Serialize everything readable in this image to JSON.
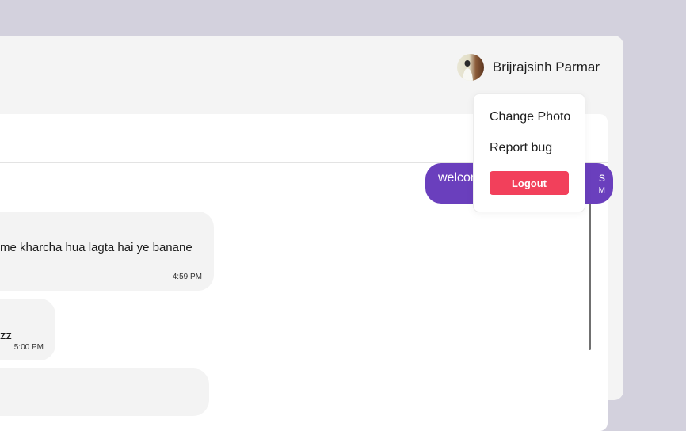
{
  "user": {
    "name": "Brijrajsinh Parmar"
  },
  "dropdown": {
    "items": [
      {
        "label": "Change Photo"
      },
      {
        "label": "Report bug"
      }
    ],
    "logout_label": "Logout"
  },
  "messages": [
    {
      "direction": "outgoing",
      "text": "welcome",
      "text_tail": "s",
      "time": "M"
    },
    {
      "direction": "incoming",
      "text": "me kharcha hua lagta hai ye banane",
      "time": "4:59 PM"
    },
    {
      "direction": "incoming",
      "text": "zz",
      "time": "5:00 PM"
    },
    {
      "direction": "incoming",
      "text": "",
      "time": ""
    }
  ],
  "colors": {
    "background": "#d3d1dd",
    "panel": "#f4f4f4",
    "outgoing_bubble": "#6a3fbd",
    "incoming_bubble": "#f3f3f3",
    "logout": "#f2405b"
  }
}
